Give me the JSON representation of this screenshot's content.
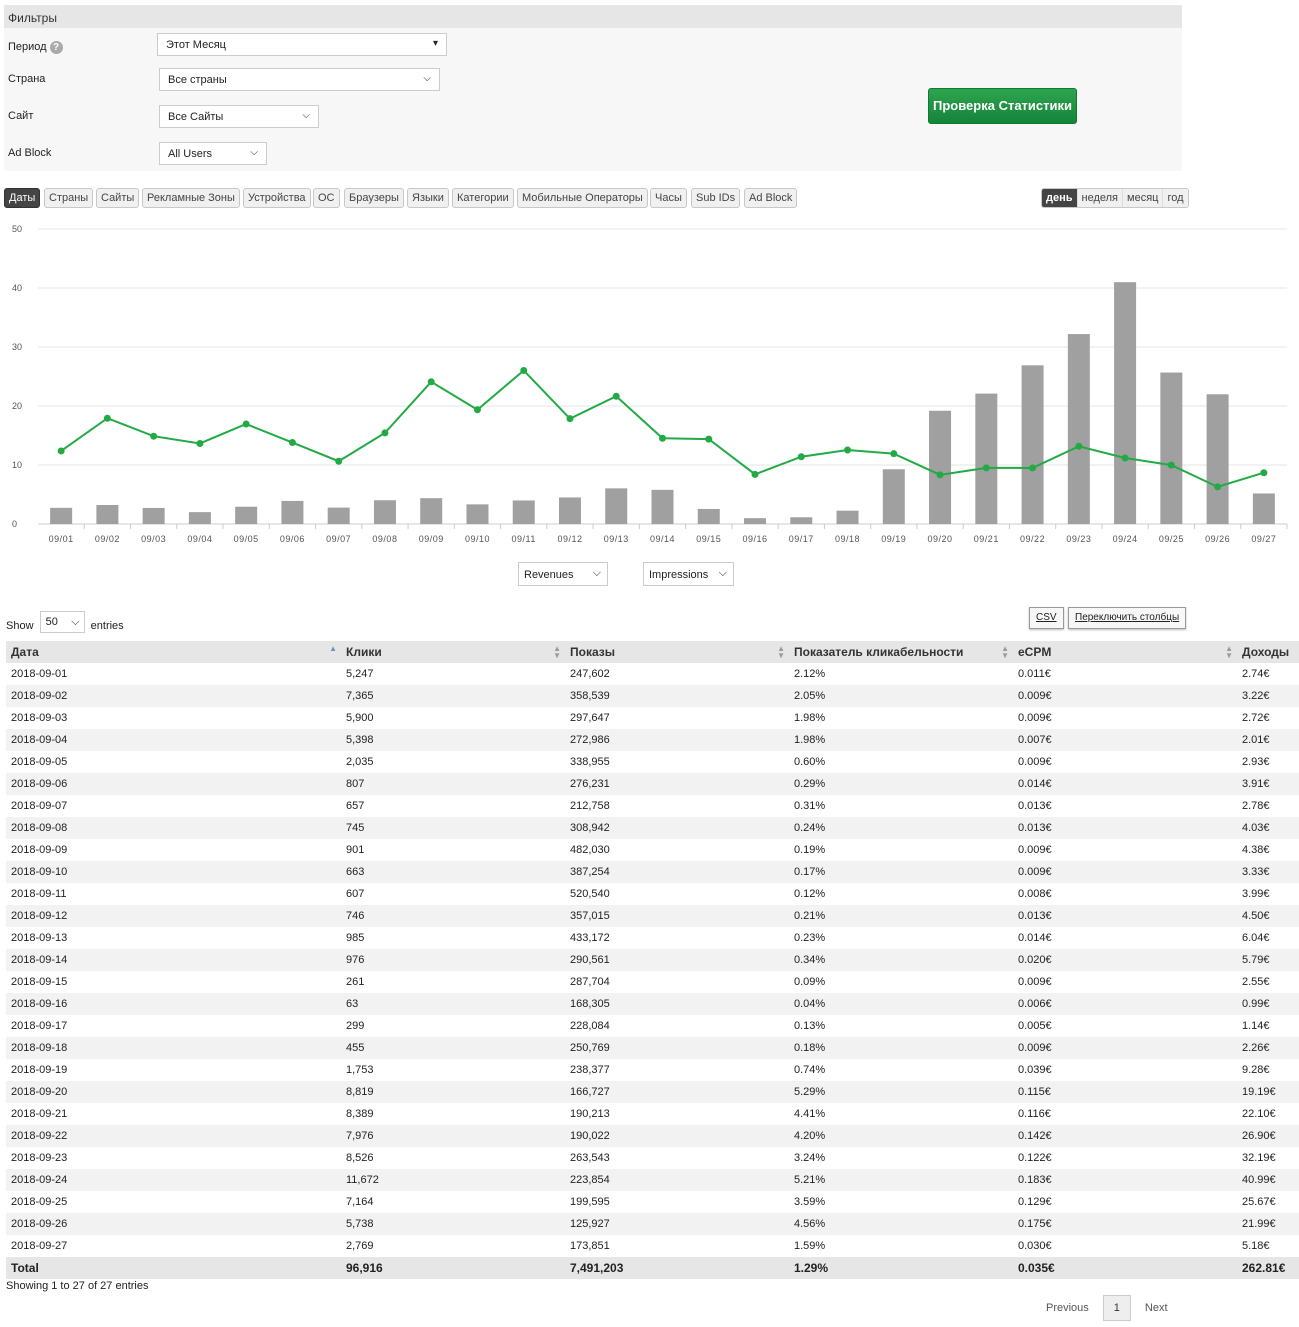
{
  "filters": {
    "title": "Фильтры",
    "period_label": "Период",
    "period_value": "Этот Месяц",
    "country_label": "Страна",
    "country_value": "Все страны",
    "site_label": "Сайт",
    "site_value": "Все Сайты",
    "adblock_label": "Ad Block",
    "adblock_value": "All Users",
    "check_button": "Проверка Статистики"
  },
  "tabs": [
    "Даты",
    "Страны",
    "Сайты",
    "Рекламные Зоны",
    "Устройства",
    "ОС",
    "Браузеры",
    "Языки",
    "Категории",
    "Мобильные Операторы",
    "Часы",
    "Sub IDs",
    "Ad Block"
  ],
  "periods": [
    "день",
    "неделя",
    "месяц",
    "год"
  ],
  "chart_data": {
    "type": "bar+line",
    "ylim": [
      0,
      50
    ],
    "yticks": [
      "0",
      "10",
      "20",
      "30",
      "40",
      "50"
    ],
    "categories": [
      "09/01",
      "09/02",
      "09/03",
      "09/04",
      "09/05",
      "09/06",
      "09/07",
      "09/08",
      "09/09",
      "09/10",
      "09/11",
      "09/12",
      "09/13",
      "09/14",
      "09/15",
      "09/16",
      "09/17",
      "09/18",
      "09/19",
      "09/20",
      "09/21",
      "09/22",
      "09/23",
      "09/24",
      "09/25",
      "09/26",
      "09/27"
    ],
    "series": [
      {
        "name": "Revenues",
        "type": "bar",
        "color": "#a0a0a0",
        "values": [
          2.74,
          3.22,
          2.72,
          2.01,
          2.93,
          3.91,
          2.78,
          4.03,
          4.38,
          3.33,
          3.99,
          4.5,
          6.04,
          5.79,
          2.55,
          0.99,
          1.14,
          2.26,
          9.28,
          19.19,
          22.1,
          26.9,
          32.19,
          40.99,
          25.67,
          21.99,
          5.18
        ]
      },
      {
        "name": "Impressions",
        "type": "line",
        "color": "#22aa44",
        "values": [
          247602,
          358539,
          297647,
          272986,
          338955,
          276231,
          212758,
          308942,
          482030,
          387254,
          520540,
          357015,
          433172,
          290561,
          287704,
          168305,
          228084,
          250769,
          238377,
          166727,
          190213,
          190022,
          263543,
          223854,
          199595,
          125927,
          173851
        ]
      }
    ]
  },
  "chart_selects": {
    "left": "Revenues",
    "right": "Impressions"
  },
  "table_controls": {
    "show": "Show",
    "entries_value": "50",
    "entries": "entries",
    "csv": "CSV",
    "toggle_columns": "Переключить столбцы"
  },
  "table": {
    "headers": [
      "Дата",
      "Клики",
      "Показы",
      "Показатель кликабельности",
      "eCPM",
      "Доходы"
    ],
    "rows": [
      [
        "2018-09-01",
        "5,247",
        "247,602",
        "2.12%",
        "0.011€",
        "2.74€"
      ],
      [
        "2018-09-02",
        "7,365",
        "358,539",
        "2.05%",
        "0.009€",
        "3.22€"
      ],
      [
        "2018-09-03",
        "5,900",
        "297,647",
        "1.98%",
        "0.009€",
        "2.72€"
      ],
      [
        "2018-09-04",
        "5,398",
        "272,986",
        "1.98%",
        "0.007€",
        "2.01€"
      ],
      [
        "2018-09-05",
        "2,035",
        "338,955",
        "0.60%",
        "0.009€",
        "2.93€"
      ],
      [
        "2018-09-06",
        "807",
        "276,231",
        "0.29%",
        "0.014€",
        "3.91€"
      ],
      [
        "2018-09-07",
        "657",
        "212,758",
        "0.31%",
        "0.013€",
        "2.78€"
      ],
      [
        "2018-09-08",
        "745",
        "308,942",
        "0.24%",
        "0.013€",
        "4.03€"
      ],
      [
        "2018-09-09",
        "901",
        "482,030",
        "0.19%",
        "0.009€",
        "4.38€"
      ],
      [
        "2018-09-10",
        "663",
        "387,254",
        "0.17%",
        "0.009€",
        "3.33€"
      ],
      [
        "2018-09-11",
        "607",
        "520,540",
        "0.12%",
        "0.008€",
        "3.99€"
      ],
      [
        "2018-09-12",
        "746",
        "357,015",
        "0.21%",
        "0.013€",
        "4.50€"
      ],
      [
        "2018-09-13",
        "985",
        "433,172",
        "0.23%",
        "0.014€",
        "6.04€"
      ],
      [
        "2018-09-14",
        "976",
        "290,561",
        "0.34%",
        "0.020€",
        "5.79€"
      ],
      [
        "2018-09-15",
        "261",
        "287,704",
        "0.09%",
        "0.009€",
        "2.55€"
      ],
      [
        "2018-09-16",
        "63",
        "168,305",
        "0.04%",
        "0.006€",
        "0.99€"
      ],
      [
        "2018-09-17",
        "299",
        "228,084",
        "0.13%",
        "0.005€",
        "1.14€"
      ],
      [
        "2018-09-18",
        "455",
        "250,769",
        "0.18%",
        "0.009€",
        "2.26€"
      ],
      [
        "2018-09-19",
        "1,753",
        "238,377",
        "0.74%",
        "0.039€",
        "9.28€"
      ],
      [
        "2018-09-20",
        "8,819",
        "166,727",
        "5.29%",
        "0.115€",
        "19.19€"
      ],
      [
        "2018-09-21",
        "8,389",
        "190,213",
        "4.41%",
        "0.116€",
        "22.10€"
      ],
      [
        "2018-09-22",
        "7,976",
        "190,022",
        "4.20%",
        "0.142€",
        "26.90€"
      ],
      [
        "2018-09-23",
        "8,526",
        "263,543",
        "3.24%",
        "0.122€",
        "32.19€"
      ],
      [
        "2018-09-24",
        "11,672",
        "223,854",
        "5.21%",
        "0.183€",
        "40.99€"
      ],
      [
        "2018-09-25",
        "7,164",
        "199,595",
        "3.59%",
        "0.129€",
        "25.67€"
      ],
      [
        "2018-09-26",
        "5,738",
        "125,927",
        "4.56%",
        "0.175€",
        "21.99€"
      ],
      [
        "2018-09-27",
        "2,769",
        "173,851",
        "1.59%",
        "0.030€",
        "5.18€"
      ]
    ],
    "total": [
      "Total",
      "96,916",
      "7,491,203",
      "1.29%",
      "0.035€",
      "262.81€"
    ]
  },
  "info": "Showing 1 to 27 of 27 entries",
  "pager": {
    "previous": "Previous",
    "page": "1",
    "next": "Next"
  }
}
